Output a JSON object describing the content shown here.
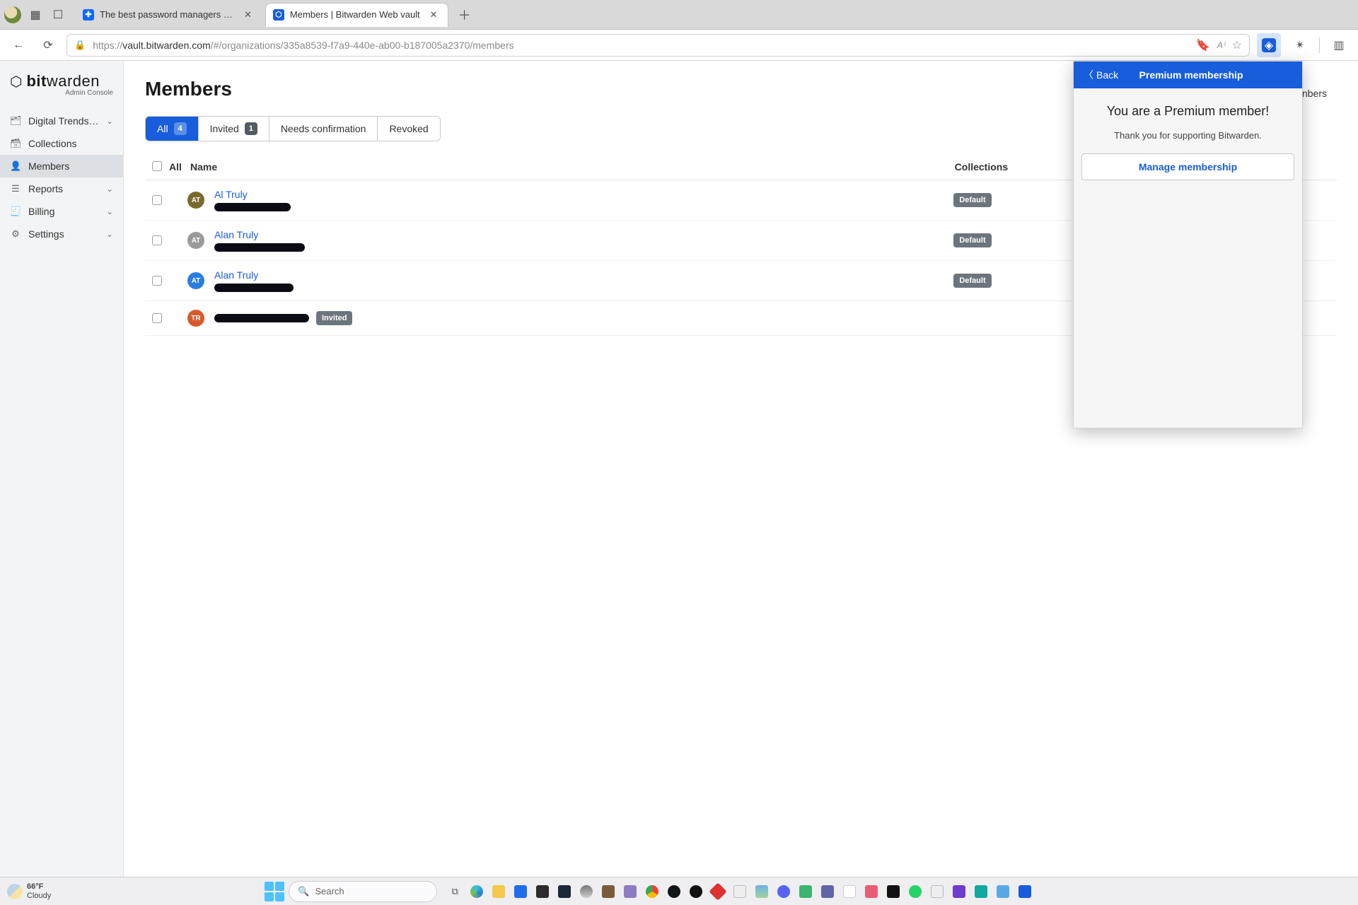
{
  "browser": {
    "tabs": [
      {
        "title": "The best password managers for",
        "active": false,
        "favicon": "dt"
      },
      {
        "title": "Members | Bitwarden Web vault",
        "active": true,
        "favicon": "bw"
      }
    ],
    "url_display_prefix": "https://",
    "url_host": "vault.bitwarden.com",
    "url_path": "/#/organizations/335a8539-f7a9-440e-ab00-b187005a2370/members"
  },
  "brand": {
    "bold": "bit",
    "rest": "warden",
    "sub": "Admin Console"
  },
  "nav": {
    "items": [
      {
        "label": "Digital Trends revi...",
        "icon": "📰",
        "chev": true,
        "active": false
      },
      {
        "label": "Collections",
        "icon": "📁",
        "chev": false,
        "active": false
      },
      {
        "label": "Members",
        "icon": "👤",
        "chev": false,
        "active": true
      },
      {
        "label": "Reports",
        "icon": "📊",
        "chev": true,
        "active": false
      },
      {
        "label": "Billing",
        "icon": "💳",
        "chev": true,
        "active": false
      },
      {
        "label": "Settings",
        "icon": "⚙",
        "chev": true,
        "active": false
      }
    ]
  },
  "page": {
    "title": "Members"
  },
  "filter_tabs": {
    "all": {
      "label": "All",
      "count": "4"
    },
    "invited": {
      "label": "Invited",
      "count": "1"
    },
    "needs": {
      "label": "Needs confirmation"
    },
    "revoked": {
      "label": "Revoked"
    }
  },
  "table": {
    "head_all": "All",
    "head_name": "Name",
    "head_collections": "Collections",
    "collections_peek": "nbers",
    "rows": [
      {
        "avatar_text": "AT",
        "avatar_bg": "#7a6a2e",
        "name": "Al Truly",
        "redact_w": 108,
        "coll_badge": "Default",
        "invited": false
      },
      {
        "avatar_text": "AT",
        "avatar_bg": "#9a9a9a",
        "name": "Alan Truly",
        "redact_w": 128,
        "coll_badge": "Default",
        "invited": false
      },
      {
        "avatar_text": "AT",
        "avatar_bg": "#2a7de1",
        "name": "Alan Truly",
        "redact_w": 112,
        "coll_badge": "Default",
        "invited": false
      },
      {
        "avatar_text": "TR",
        "avatar_bg": "#d85a2b",
        "name": "",
        "redact_w": 134,
        "coll_badge": "",
        "invited": true,
        "invited_label": "Invited"
      }
    ]
  },
  "ext_panel": {
    "back": "Back",
    "title": "Premium membership",
    "heading": "You are a Premium member!",
    "thanks": "Thank you for supporting Bitwarden.",
    "manage": "Manage membership"
  },
  "taskbar": {
    "temp": "66°F",
    "cond": "Cloudy",
    "search_placeholder": "Search"
  }
}
